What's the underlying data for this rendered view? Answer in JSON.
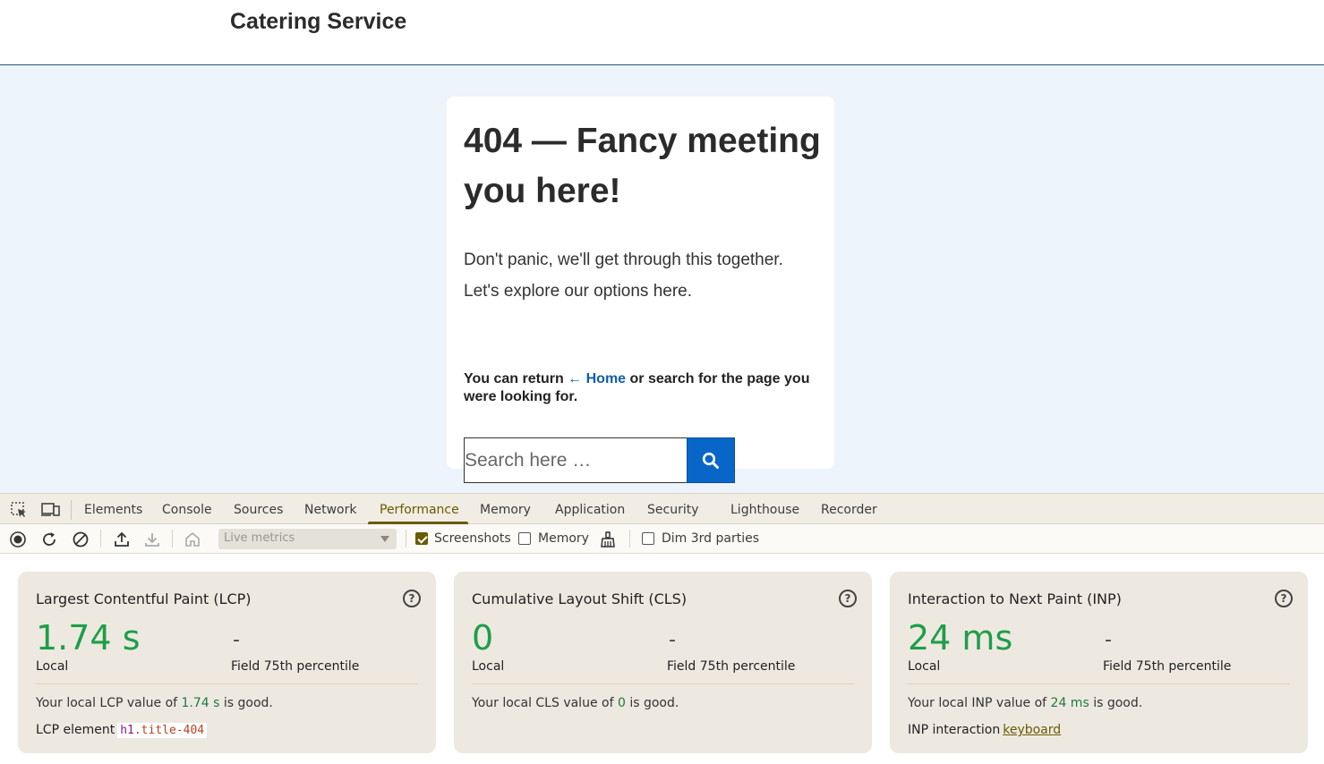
{
  "site": {
    "title": "Catering Service",
    "heading": "404 — Fancy meeting you here!",
    "lead": "Don't panic, we'll get through this together. Let's explore our options here.",
    "return_prefix": "You can return ",
    "home_link": "← Home",
    "return_suffix": " or search for the page you were looking for.",
    "search_placeholder": "Search here …"
  },
  "devtools": {
    "tabs": [
      "Elements",
      "Console",
      "Sources",
      "Network",
      "Performance",
      "Memory",
      "Application",
      "Security",
      "Lighthouse",
      "Recorder"
    ],
    "active_tab": "Performance",
    "toolbar": {
      "live_metrics": "Live metrics",
      "screenshots_label": "Screenshots",
      "screenshots_checked": true,
      "memory_label": "Memory",
      "memory_checked": false,
      "dim_label": "Dim 3rd parties",
      "dim_checked": false
    },
    "metrics": [
      {
        "title": "Largest Contentful Paint (LCP)",
        "value": "1.74 s",
        "local_label": "Local",
        "field_value": "-",
        "field_label": "Field 75th percentile",
        "note_prefix": "Your local LCP value of ",
        "note_value": "1.74 s",
        "note_suffix": " is good.",
        "extra_label": "LCP element",
        "extra_tag": "h1",
        "extra_class": ".title-404"
      },
      {
        "title": "Cumulative Layout Shift (CLS)",
        "value": "0",
        "local_label": "Local",
        "field_value": "-",
        "field_label": "Field 75th percentile",
        "note_prefix": "Your local CLS value of ",
        "note_value": "0",
        "note_suffix": " is good."
      },
      {
        "title": "Interaction to Next Paint (INP)",
        "value": "24 ms",
        "local_label": "Local",
        "field_value": "-",
        "field_label": "Field 75th percentile",
        "note_prefix": "Your local INP value of ",
        "note_value": "24 ms",
        "note_suffix": " is good.",
        "extra_label": "INP interaction",
        "extra_link": "keyboard"
      }
    ],
    "colors": {
      "good": "#1e9e48",
      "accent": "#6a5a00",
      "search_button": "#0966c9"
    }
  }
}
